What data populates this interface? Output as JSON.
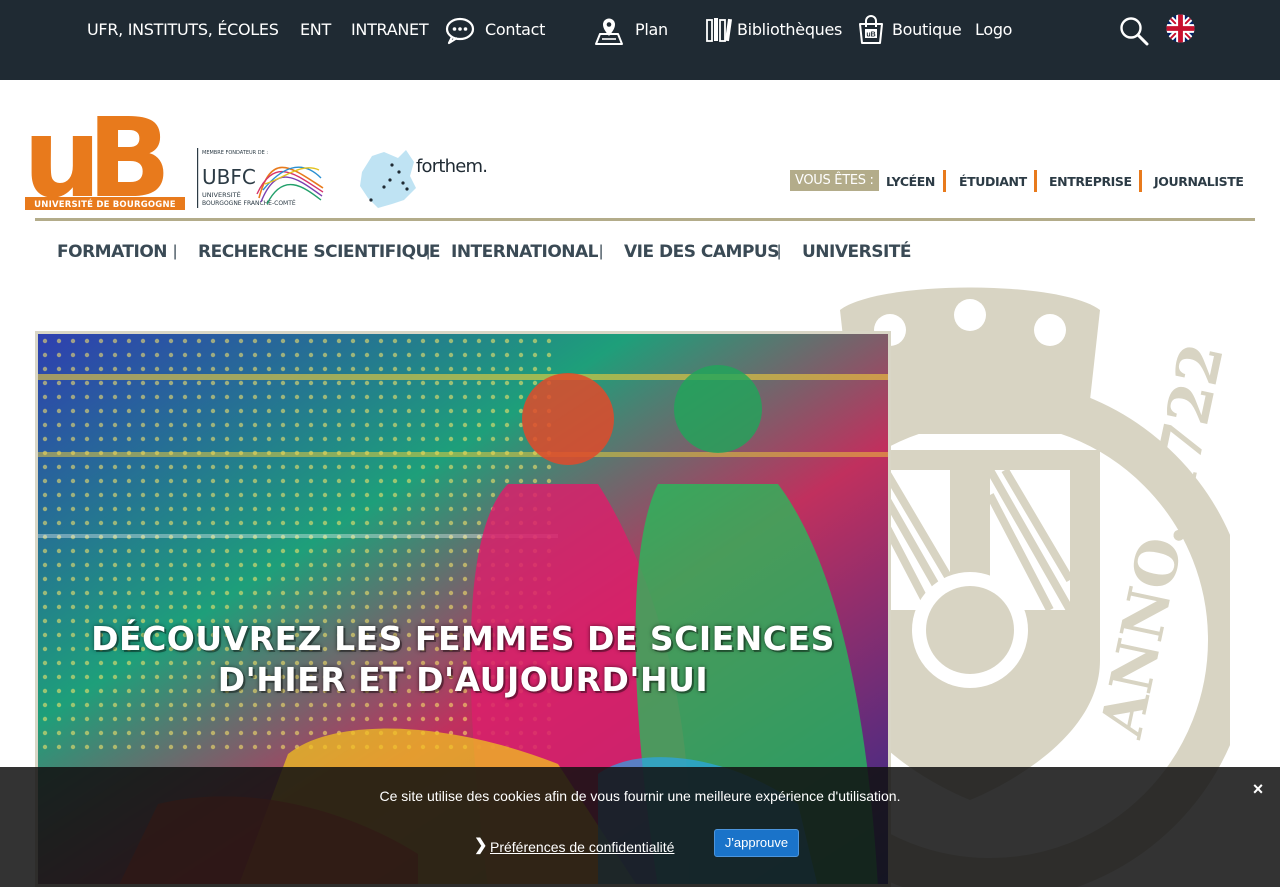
{
  "topbar": {
    "links": {
      "ufr": "UFR, INSTITUTS, ÉCOLES",
      "ent": "ENT",
      "intranet": "INTRANET",
      "contact": "Contact",
      "plan": "Plan",
      "bibliotheques": "Bibliothèques",
      "boutique": "Boutique",
      "logo": "Logo"
    },
    "icons": {
      "contact": "speech-bubble-icon",
      "plan": "map-pin-icon",
      "bibliotheques": "books-icon",
      "boutique": "shopping-bag-icon",
      "search": "search-icon",
      "language": "uk-flag-icon"
    }
  },
  "header": {
    "logo_ub": {
      "letters": "uB",
      "caption": "UNIVERSITÉ DE BOURGOGNE"
    },
    "logo_ubfc": {
      "small_caption": "MEMBRE FONDATEUR DE :",
      "acronym": "UBFC",
      "line1": "UNIVERSITÉ",
      "line2": "BOURGOGNE FRANCHE-COMTÉ"
    },
    "logo_forthem": {
      "text": "forthem."
    },
    "audience": {
      "label": "VOUS ÊTES :",
      "items": [
        "LYCÉEN",
        "ÉTUDIANT",
        "ENTREPRISE",
        "JOURNALISTE"
      ]
    }
  },
  "mainnav": {
    "items": [
      "FORMATION",
      "RECHERCHE SCIENTIFIQUE",
      "INTERNATIONAL",
      "VIE DES CAMPUS",
      "UNIVERSITÉ"
    ],
    "separator": "|"
  },
  "seal": {
    "legend": "ANNO. 1722"
  },
  "hero": {
    "line1": "DÉCOUVREZ LES FEMMES DE SCIENCES",
    "line2": "D'HIER ET D'AUJOURD'HUI"
  },
  "cookie": {
    "message": "Ce site utilise des cookies afin de vous fournir une meilleure expérience d'utilisation.",
    "close": "×",
    "chevron": "❯",
    "preferences": "Préférences de confidentialité",
    "approve": "J'approuve"
  },
  "colors": {
    "topbar_bg": "#1f2a33",
    "brand_orange": "#e87a1c",
    "brand_khaki": "#b3ac8a",
    "nav_text": "#3a4a55",
    "approve_button": "#1a73c9"
  }
}
